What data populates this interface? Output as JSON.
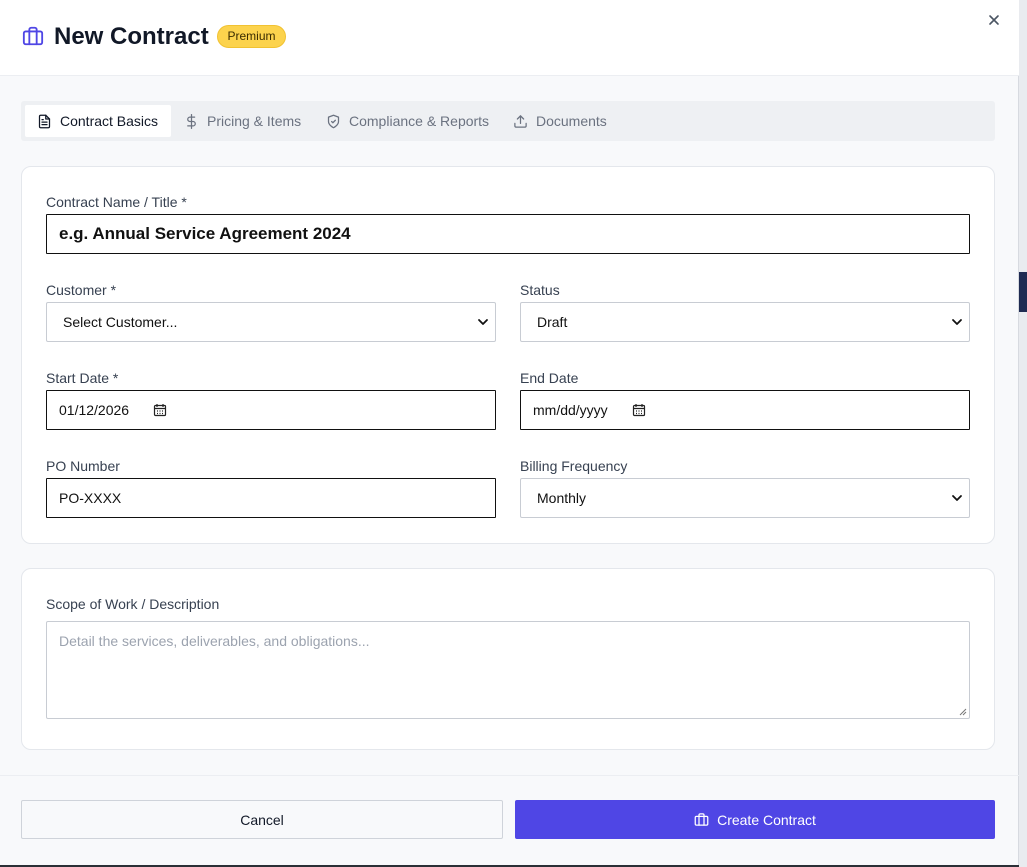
{
  "header": {
    "title": "New Contract",
    "badge": "Premium",
    "icon": "briefcase-icon",
    "close_icon": "close-icon"
  },
  "tabs": [
    {
      "label": "Contract Basics",
      "icon": "document-icon",
      "active": true
    },
    {
      "label": "Pricing & Items",
      "icon": "dollar-icon",
      "active": false
    },
    {
      "label": "Compliance & Reports",
      "icon": "shield-check-icon",
      "active": false
    },
    {
      "label": "Documents",
      "icon": "upload-icon",
      "active": false
    }
  ],
  "form": {
    "contract_name": {
      "label": "Contract Name / Title *",
      "value": "e.g. Annual Service Agreement 2024"
    },
    "customer": {
      "label": "Customer *",
      "value": "Select Customer..."
    },
    "status": {
      "label": "Status",
      "value": "Draft"
    },
    "start_date": {
      "label": "Start Date *",
      "value": "01/12/2026"
    },
    "end_date": {
      "label": "End Date",
      "value": "mm/dd/yyyy"
    },
    "po_number": {
      "label": "PO Number",
      "value": "PO-XXXX"
    },
    "billing_frequency": {
      "label": "Billing Frequency",
      "value": "Monthly"
    }
  },
  "scope": {
    "label": "Scope of Work / Description",
    "placeholder": "Detail the services, deliverables, and obligations..."
  },
  "footer": {
    "cancel_label": "Cancel",
    "create_label": "Create Contract"
  },
  "colors": {
    "accent": "#4f46e5",
    "badge": "#fcd34d",
    "icon_purple": "#4f46e5"
  }
}
